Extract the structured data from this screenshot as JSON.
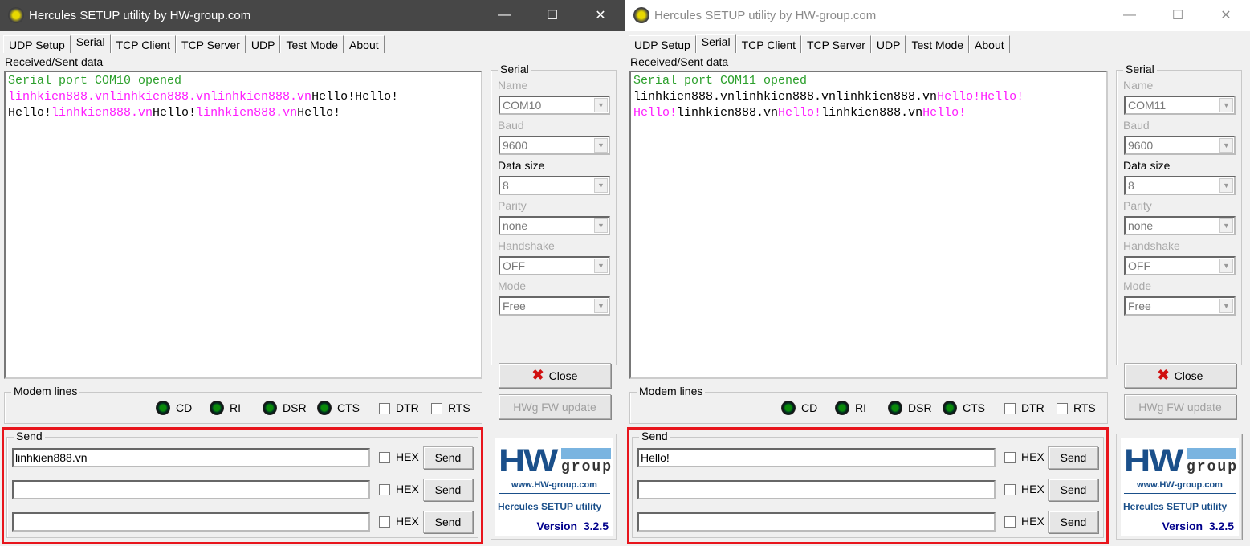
{
  "tabs": [
    "UDP Setup",
    "Serial",
    "TCP Client",
    "TCP Server",
    "UDP",
    "Test Mode",
    "About"
  ],
  "colors": {
    "opened": "#2ca02c",
    "sent": "#ff1cff",
    "received": "#000000",
    "highlight": "#e8151c",
    "logo_blue": "#1a4f8a",
    "version_navy": "#00008b"
  },
  "windows": [
    {
      "title": "Hercules SETUP utility by HW-group.com",
      "state": "active",
      "received_label": "Received/Sent data",
      "received_lines": [
        [
          {
            "t": "Serial port COM10 opened",
            "c": "opened"
          }
        ],
        [
          {
            "t": "linhkien888.vnlinhkien888.vnlinhkien888.vn",
            "c": "sent"
          },
          {
            "t": "Hello!Hello!",
            "c": "received"
          }
        ],
        [
          {
            "t": "Hello!",
            "c": "received"
          },
          {
            "t": "linhkien888.vn",
            "c": "sent"
          },
          {
            "t": "Hello!",
            "c": "received"
          },
          {
            "t": "linhkien888.vn",
            "c": "sent"
          },
          {
            "t": "Hello!",
            "c": "received"
          }
        ]
      ],
      "serial": {
        "group": "Serial",
        "name_label": "Name",
        "name": "COM10",
        "baud_label": "Baud",
        "baud": "9600",
        "data_size_label": "Data size",
        "data_size": "8",
        "parity_label": "Parity",
        "parity": "none",
        "handshake_label": "Handshake",
        "handshake": "OFF",
        "mode_label": "Mode",
        "mode": "Free",
        "close": "Close",
        "fw_update": "HWg FW update"
      },
      "modem": {
        "group": "Modem lines",
        "leds": [
          "CD",
          "RI",
          "DSR",
          "CTS"
        ],
        "checks": [
          "DTR",
          "RTS"
        ]
      },
      "send": {
        "group": "Send",
        "rows": [
          {
            "value": "linhkien888.vn",
            "hex": "HEX",
            "button": "Send"
          },
          {
            "value": "",
            "hex": "HEX",
            "button": "Send"
          },
          {
            "value": "",
            "hex": "HEX",
            "button": "Send"
          }
        ]
      },
      "logo": {
        "brand": "HW",
        "group": "group",
        "url": "www.HW-group.com",
        "product": "Hercules SETUP utility",
        "version": "Version  3.2.5"
      }
    },
    {
      "title": "Hercules SETUP utility by HW-group.com",
      "state": "inactive",
      "received_label": "Received/Sent data",
      "received_lines": [
        [
          {
            "t": "Serial port COM11 opened",
            "c": "opened"
          }
        ],
        [
          {
            "t": "linhkien888.vnlinhkien888.vnlinhkien888.vn",
            "c": "received"
          },
          {
            "t": "Hello!Hello!",
            "c": "sent"
          }
        ],
        [
          {
            "t": "Hello!",
            "c": "sent"
          },
          {
            "t": "linhkien888.vn",
            "c": "received"
          },
          {
            "t": "Hello!",
            "c": "sent"
          },
          {
            "t": "linhkien888.vn",
            "c": "received"
          },
          {
            "t": "Hello!",
            "c": "sent"
          }
        ]
      ],
      "serial": {
        "group": "Serial",
        "name_label": "Name",
        "name": "COM11",
        "baud_label": "Baud",
        "baud": "9600",
        "data_size_label": "Data size",
        "data_size": "8",
        "parity_label": "Parity",
        "parity": "none",
        "handshake_label": "Handshake",
        "handshake": "OFF",
        "mode_label": "Mode",
        "mode": "Free",
        "close": "Close",
        "fw_update": "HWg FW update"
      },
      "modem": {
        "group": "Modem lines",
        "leds": [
          "CD",
          "RI",
          "DSR",
          "CTS"
        ],
        "checks": [
          "DTR",
          "RTS"
        ]
      },
      "send": {
        "group": "Send",
        "rows": [
          {
            "value": "Hello!",
            "hex": "HEX",
            "button": "Send"
          },
          {
            "value": "",
            "hex": "HEX",
            "button": "Send"
          },
          {
            "value": "",
            "hex": "HEX",
            "button": "Send"
          }
        ]
      },
      "logo": {
        "brand": "HW",
        "group": "group",
        "url": "www.HW-group.com",
        "product": "Hercules SETUP utility",
        "version": "Version  3.2.5"
      }
    }
  ]
}
